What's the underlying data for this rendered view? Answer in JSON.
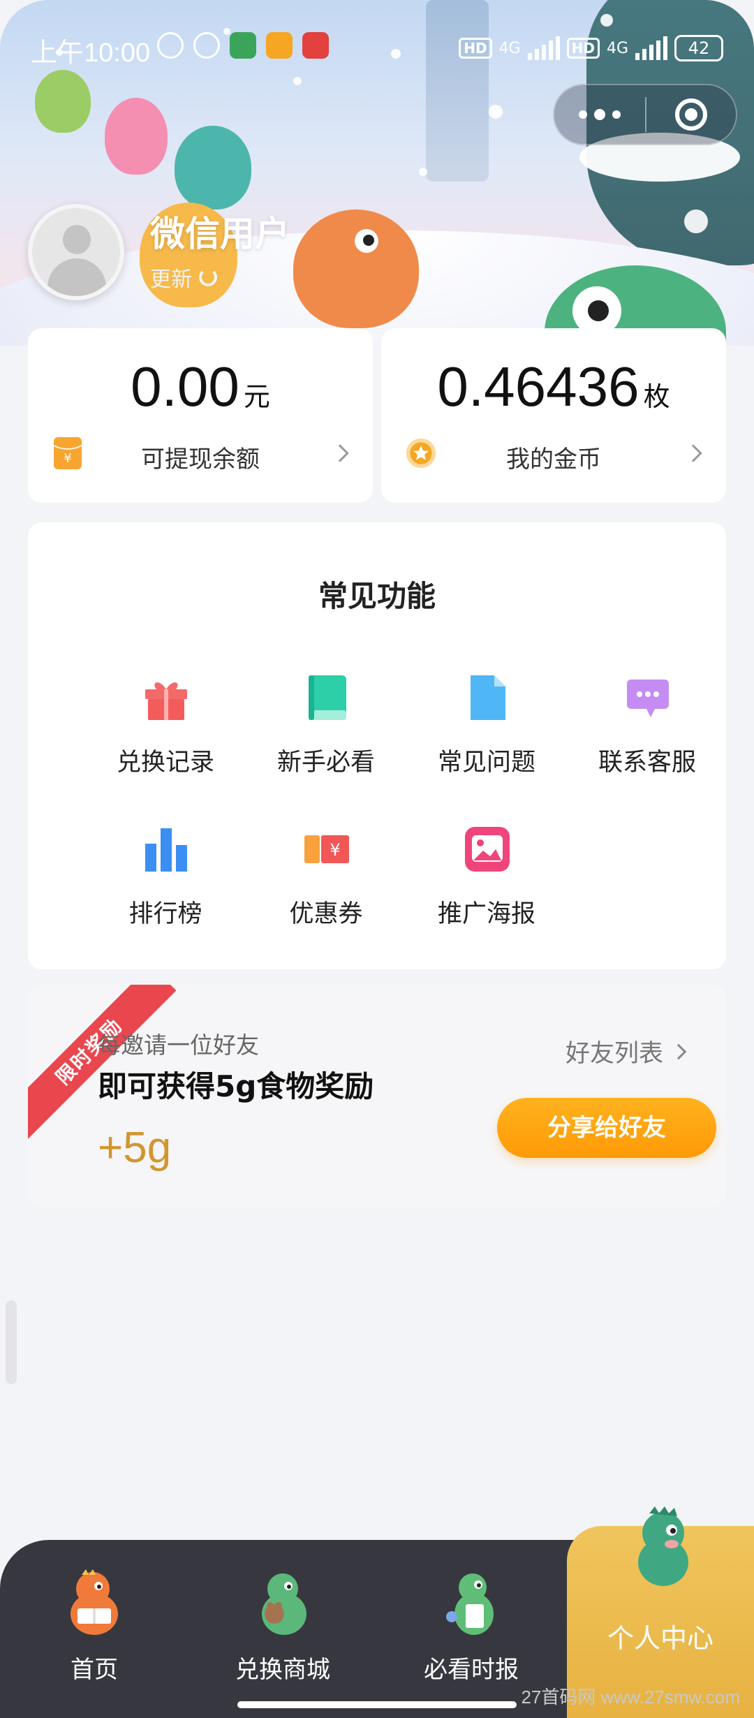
{
  "status_bar": {
    "time": "上午10:00",
    "network_1": "4G",
    "network_2": "4G",
    "hd_1": "HD",
    "hd_2": "HD",
    "battery": "42"
  },
  "profile": {
    "username": "微信用户",
    "refresh_label": "更新"
  },
  "balance": {
    "cash_amount": "0.00",
    "cash_unit": "元",
    "cash_label": "可提现余额",
    "coins_amount": "0.46436",
    "coins_unit": "枚",
    "coins_label": "我的金币"
  },
  "functions": {
    "title": "常见功能",
    "items": [
      {
        "label": "兑换记录",
        "icon": "gift-icon"
      },
      {
        "label": "新手必看",
        "icon": "book-icon"
      },
      {
        "label": "常见问题",
        "icon": "document-icon"
      },
      {
        "label": "联系客服",
        "icon": "chat-bubble-icon"
      },
      {
        "label": "排行榜",
        "icon": "bar-chart-icon"
      },
      {
        "label": "优惠券",
        "icon": "coupon-icon"
      },
      {
        "label": "推广海报",
        "icon": "image-poster-icon"
      }
    ]
  },
  "invite": {
    "ribbon": "限时奖励",
    "subtitle": "每邀请一位好友",
    "title": "即可获得5g食物奖励",
    "bonus": "+5g",
    "friend_list": "好友列表",
    "share_button": "分享给好友"
  },
  "tabbar": {
    "tabs": [
      {
        "label": "首页",
        "icon": "dino-reading-icon"
      },
      {
        "label": "兑换商城",
        "icon": "dino-shop-icon"
      },
      {
        "label": "必看时报",
        "icon": "dino-news-icon"
      },
      {
        "label": "个人中心",
        "icon": "dino-profile-icon"
      }
    ],
    "active_index": 3
  },
  "watermark": "27首码网 www.27smw.com",
  "colors": {
    "accent_orange": "#ff9a07",
    "tab_active": "#e7b241",
    "tabbar_bg": "#37383f",
    "bonus_gold": "#d1962f",
    "ribbon_red": "#e9464e"
  }
}
